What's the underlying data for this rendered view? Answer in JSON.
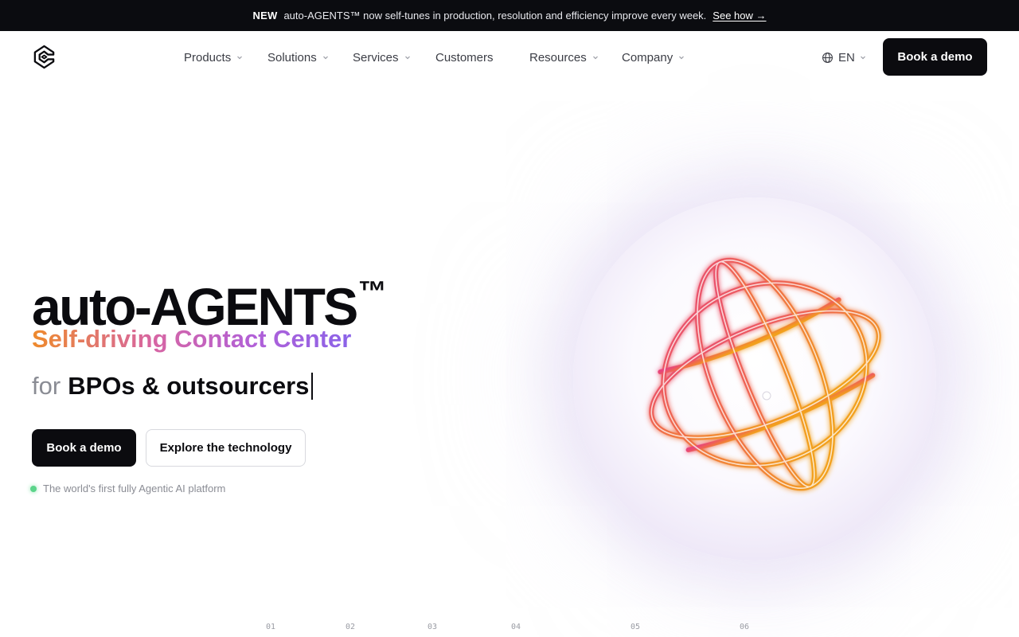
{
  "announcement": {
    "tag": "NEW",
    "text": "auto-AGENTS™ now self-tunes in production, resolution and efficiency improve every week.",
    "link": "See how →"
  },
  "nav": {
    "items": [
      {
        "label": "Products",
        "has_menu": true
      },
      {
        "label": "Solutions",
        "has_menu": true
      },
      {
        "label": "Services",
        "has_menu": true
      },
      {
        "label": "Customers",
        "has_menu": false
      },
      {
        "label": "Resources",
        "has_menu": true
      },
      {
        "label": "Company",
        "has_menu": true
      }
    ],
    "language": "EN",
    "cta": "Book a demo"
  },
  "hero": {
    "title": "auto-AGENTS",
    "title_mark": "™",
    "subtitle": "Self-driving Contact Center",
    "for_prefix": "for",
    "for_audience": "BPOs & outsourcers",
    "primary_cta": "Book a demo",
    "secondary_cta": "Explore the technology",
    "tagline": "The world's first fully Agentic AI platform"
  },
  "steps": [
    "01",
    "02",
    "03",
    "04",
    "05",
    "06"
  ],
  "colors": {
    "announcement_bg": "#0b0c10",
    "button_dark": "#0b0b0f",
    "gradient_start": "#ee8a2c",
    "gradient_end": "#8a63e8",
    "status_dot": "#5bd48a"
  }
}
